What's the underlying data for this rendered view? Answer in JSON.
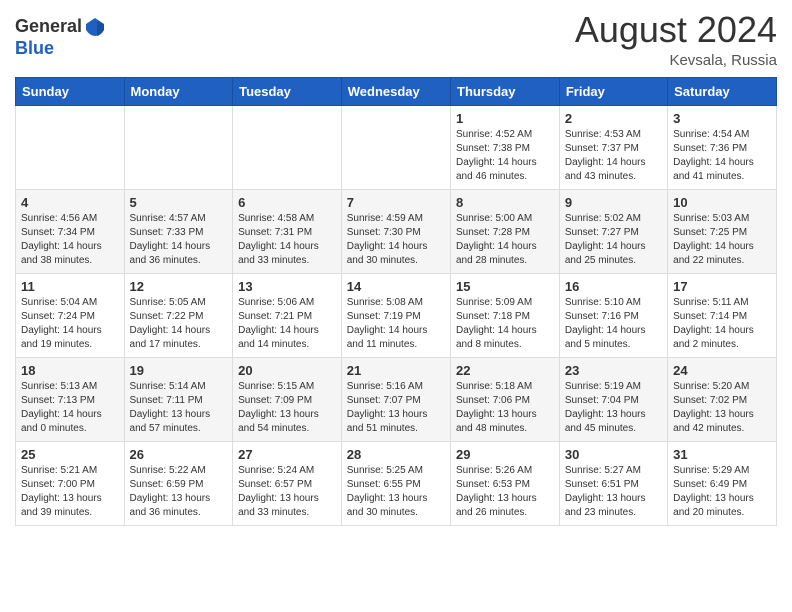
{
  "logo": {
    "general": "General",
    "blue": "Blue"
  },
  "header": {
    "month": "August 2024",
    "location": "Kevsala, Russia"
  },
  "weekdays": [
    "Sunday",
    "Monday",
    "Tuesday",
    "Wednesday",
    "Thursday",
    "Friday",
    "Saturday"
  ],
  "weeks": [
    [
      {
        "day": "",
        "info": ""
      },
      {
        "day": "",
        "info": ""
      },
      {
        "day": "",
        "info": ""
      },
      {
        "day": "",
        "info": ""
      },
      {
        "day": "1",
        "info": "Sunrise: 4:52 AM\nSunset: 7:38 PM\nDaylight: 14 hours\nand 46 minutes."
      },
      {
        "day": "2",
        "info": "Sunrise: 4:53 AM\nSunset: 7:37 PM\nDaylight: 14 hours\nand 43 minutes."
      },
      {
        "day": "3",
        "info": "Sunrise: 4:54 AM\nSunset: 7:36 PM\nDaylight: 14 hours\nand 41 minutes."
      }
    ],
    [
      {
        "day": "4",
        "info": "Sunrise: 4:56 AM\nSunset: 7:34 PM\nDaylight: 14 hours\nand 38 minutes."
      },
      {
        "day": "5",
        "info": "Sunrise: 4:57 AM\nSunset: 7:33 PM\nDaylight: 14 hours\nand 36 minutes."
      },
      {
        "day": "6",
        "info": "Sunrise: 4:58 AM\nSunset: 7:31 PM\nDaylight: 14 hours\nand 33 minutes."
      },
      {
        "day": "7",
        "info": "Sunrise: 4:59 AM\nSunset: 7:30 PM\nDaylight: 14 hours\nand 30 minutes."
      },
      {
        "day": "8",
        "info": "Sunrise: 5:00 AM\nSunset: 7:28 PM\nDaylight: 14 hours\nand 28 minutes."
      },
      {
        "day": "9",
        "info": "Sunrise: 5:02 AM\nSunset: 7:27 PM\nDaylight: 14 hours\nand 25 minutes."
      },
      {
        "day": "10",
        "info": "Sunrise: 5:03 AM\nSunset: 7:25 PM\nDaylight: 14 hours\nand 22 minutes."
      }
    ],
    [
      {
        "day": "11",
        "info": "Sunrise: 5:04 AM\nSunset: 7:24 PM\nDaylight: 14 hours\nand 19 minutes."
      },
      {
        "day": "12",
        "info": "Sunrise: 5:05 AM\nSunset: 7:22 PM\nDaylight: 14 hours\nand 17 minutes."
      },
      {
        "day": "13",
        "info": "Sunrise: 5:06 AM\nSunset: 7:21 PM\nDaylight: 14 hours\nand 14 minutes."
      },
      {
        "day": "14",
        "info": "Sunrise: 5:08 AM\nSunset: 7:19 PM\nDaylight: 14 hours\nand 11 minutes."
      },
      {
        "day": "15",
        "info": "Sunrise: 5:09 AM\nSunset: 7:18 PM\nDaylight: 14 hours\nand 8 minutes."
      },
      {
        "day": "16",
        "info": "Sunrise: 5:10 AM\nSunset: 7:16 PM\nDaylight: 14 hours\nand 5 minutes."
      },
      {
        "day": "17",
        "info": "Sunrise: 5:11 AM\nSunset: 7:14 PM\nDaylight: 14 hours\nand 2 minutes."
      }
    ],
    [
      {
        "day": "18",
        "info": "Sunrise: 5:13 AM\nSunset: 7:13 PM\nDaylight: 14 hours\nand 0 minutes."
      },
      {
        "day": "19",
        "info": "Sunrise: 5:14 AM\nSunset: 7:11 PM\nDaylight: 13 hours\nand 57 minutes."
      },
      {
        "day": "20",
        "info": "Sunrise: 5:15 AM\nSunset: 7:09 PM\nDaylight: 13 hours\nand 54 minutes."
      },
      {
        "day": "21",
        "info": "Sunrise: 5:16 AM\nSunset: 7:07 PM\nDaylight: 13 hours\nand 51 minutes."
      },
      {
        "day": "22",
        "info": "Sunrise: 5:18 AM\nSunset: 7:06 PM\nDaylight: 13 hours\nand 48 minutes."
      },
      {
        "day": "23",
        "info": "Sunrise: 5:19 AM\nSunset: 7:04 PM\nDaylight: 13 hours\nand 45 minutes."
      },
      {
        "day": "24",
        "info": "Sunrise: 5:20 AM\nSunset: 7:02 PM\nDaylight: 13 hours\nand 42 minutes."
      }
    ],
    [
      {
        "day": "25",
        "info": "Sunrise: 5:21 AM\nSunset: 7:00 PM\nDaylight: 13 hours\nand 39 minutes."
      },
      {
        "day": "26",
        "info": "Sunrise: 5:22 AM\nSunset: 6:59 PM\nDaylight: 13 hours\nand 36 minutes."
      },
      {
        "day": "27",
        "info": "Sunrise: 5:24 AM\nSunset: 6:57 PM\nDaylight: 13 hours\nand 33 minutes."
      },
      {
        "day": "28",
        "info": "Sunrise: 5:25 AM\nSunset: 6:55 PM\nDaylight: 13 hours\nand 30 minutes."
      },
      {
        "day": "29",
        "info": "Sunrise: 5:26 AM\nSunset: 6:53 PM\nDaylight: 13 hours\nand 26 minutes."
      },
      {
        "day": "30",
        "info": "Sunrise: 5:27 AM\nSunset: 6:51 PM\nDaylight: 13 hours\nand 23 minutes."
      },
      {
        "day": "31",
        "info": "Sunrise: 5:29 AM\nSunset: 6:49 PM\nDaylight: 13 hours\nand 20 minutes."
      }
    ]
  ]
}
